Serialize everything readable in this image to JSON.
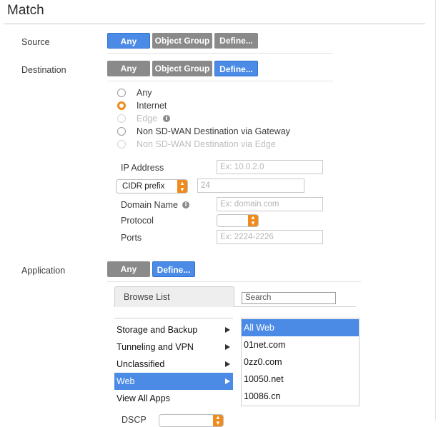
{
  "title": "Match",
  "source": {
    "label": "Source",
    "buttons": {
      "any": "Any",
      "object_group": "Object Group",
      "define": "Define..."
    }
  },
  "destination": {
    "label": "Destination",
    "buttons": {
      "any": "Any",
      "object_group": "Object Group",
      "define": "Define..."
    },
    "radios": {
      "any": "Any",
      "internet": "Internet",
      "edge": "Edge",
      "non_sdwan_gateway": "Non SD-WAN Destination via Gateway",
      "non_sdwan_edge": "Non SD-WAN Destination via Edge"
    },
    "selected_radio": "Internet",
    "ip_address": {
      "label": "IP Address",
      "placeholder": "Ex: 10.0.2.0"
    },
    "cidr": {
      "select_value": "CIDR prefix",
      "value": "24"
    },
    "domain": {
      "label": "Domain Name",
      "placeholder": "Ex: domain.com"
    },
    "protocol": {
      "label": "Protocol"
    },
    "ports": {
      "label": "Ports",
      "placeholder": "Ex: 2224-2226"
    }
  },
  "application": {
    "label": "Application",
    "buttons": {
      "any": "Any",
      "define": "Define..."
    },
    "tab_label": "Browse List",
    "search_placeholder": "Search",
    "categories": [
      {
        "label": "Storage and Backup",
        "has_arrow": true
      },
      {
        "label": "Tunneling and VPN",
        "has_arrow": true
      },
      {
        "label": "Unclassified",
        "has_arrow": true
      },
      {
        "label": "Web",
        "has_arrow": true,
        "selected": true
      },
      {
        "label": "View All Apps",
        "has_arrow": false
      }
    ],
    "apps": [
      {
        "label": "All Web",
        "selected": true
      },
      {
        "label": "01net.com"
      },
      {
        "label": "0zz0.com"
      },
      {
        "label": "10050.net"
      },
      {
        "label": "10086.cn"
      }
    ]
  },
  "dscp": {
    "label": "DSCP"
  },
  "colors": {
    "accent_blue": "#4b8be6",
    "accent_orange": "#f08a1c",
    "button_gray": "#8a8a8a"
  }
}
